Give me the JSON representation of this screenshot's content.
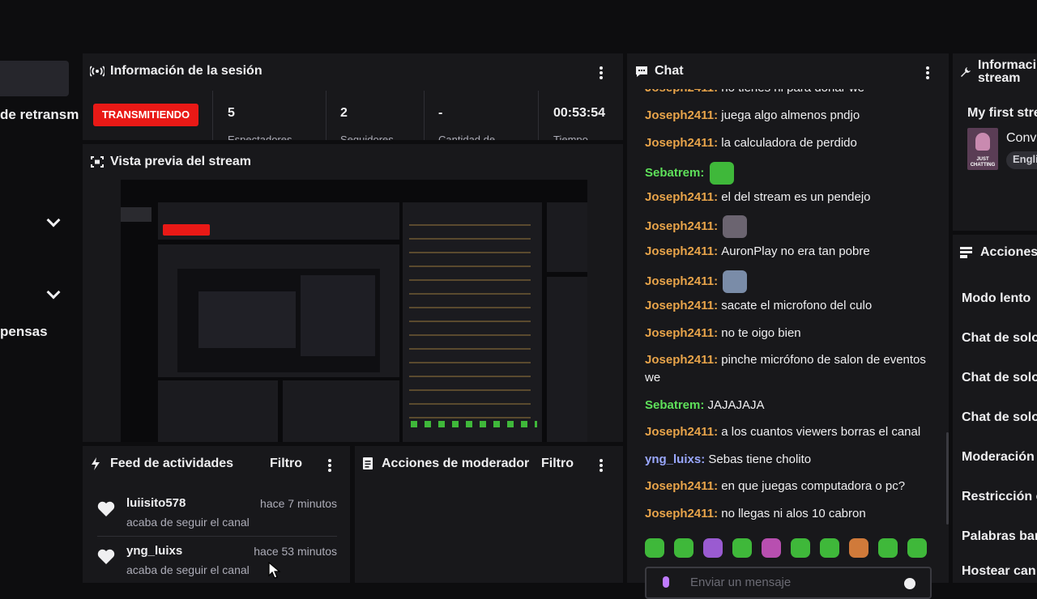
{
  "nav": {
    "item_retransmit": "de retransm",
    "item_recompensas": "pensas"
  },
  "session": {
    "title": "Información de la sesión",
    "live_badge": "TRANSMITIENDO",
    "stats": [
      {
        "value": "5",
        "label": "Espectadores"
      },
      {
        "value": "2",
        "label": "Seguidores"
      },
      {
        "value": "-",
        "label": "Cantidad de"
      },
      {
        "value": "00:53:54",
        "label": "Tiempo"
      }
    ]
  },
  "preview": {
    "title": "Vista previa del stream"
  },
  "feed": {
    "title": "Feed de actividades",
    "filter_label": "Filtro",
    "items": [
      {
        "name": "luiisito578",
        "time": "hace 7 minutos",
        "action": "acaba de seguir el canal"
      },
      {
        "name": "yng_luixs",
        "time": "hace 53 minutos",
        "action": "acaba de seguir el canal"
      }
    ]
  },
  "modactions": {
    "title": "Acciones de moderador",
    "filter_label": "Filtro"
  },
  "chat": {
    "title": "Chat",
    "input_placeholder": "Enviar un mensaje",
    "messages": [
      {
        "user": "Joseph2411",
        "text": "no tienes ni para donar we",
        "color": "#e8a44a"
      },
      {
        "user": "Joseph2411",
        "text": "juega algo almenos pndjo",
        "color": "#e8a44a"
      },
      {
        "user": "Joseph2411",
        "text": "la calculadora de perdido",
        "color": "#e8a44a"
      },
      {
        "user": "Sebatrem",
        "text": "",
        "color": "#5ee05a"
      },
      {
        "user": "Joseph2411",
        "text": "el del stream es un pendejo",
        "color": "#e8a44a"
      },
      {
        "user": "Joseph2411",
        "text": "",
        "color": "#e8a44a"
      },
      {
        "user": "Joseph2411",
        "text": "AuronPlay no era tan pobre",
        "color": "#e8a44a"
      },
      {
        "user": "Joseph2411",
        "text": "",
        "color": "#e8a44a"
      },
      {
        "user": "Joseph2411",
        "text": "sacate el microfono del culo",
        "color": "#e8a44a"
      },
      {
        "user": "Joseph2411",
        "text": "no te oigo bien",
        "color": "#e8a44a"
      },
      {
        "user": "Joseph2411",
        "text": "pinche micrófono de salon de eventos we",
        "color": "#e8a44a"
      },
      {
        "user": "Sebatrem",
        "text": "JAJAJAJA",
        "color": "#5ee05a"
      },
      {
        "user": "Joseph2411",
        "text": "a los cuantos viewers borras el canal",
        "color": "#e8a44a"
      },
      {
        "user": "yng_luixs",
        "text": "Sebas tiene cholito",
        "color": "#9aa8ff"
      },
      {
        "user": "Joseph2411",
        "text": "en que juegas computadora o pc?",
        "color": "#e8a44a"
      },
      {
        "user": "Joseph2411",
        "text": "no llegas ni alos 10 cabron",
        "color": "#e8a44a"
      }
    ]
  },
  "streaminfo": {
    "title_line1": "Informaci",
    "title_line2": "stream",
    "stream_title": "My first stre",
    "category": "Conv",
    "language_tag": "Engli",
    "thumb_text": "JUST CHATTING"
  },
  "quickactions": {
    "title": "Acciones",
    "items": [
      "Modo lento",
      "Chat de solo",
      "Chat de solo",
      "Chat de solo",
      "Moderación",
      "Restricción c",
      "Palabras bar",
      "Hostear can"
    ]
  },
  "colors": {
    "live_red": "#e91916",
    "panel_bg": "#18181b",
    "page_bg": "#0d0d0f",
    "user_orange": "#e8a44a",
    "user_green": "#5ee05a",
    "user_blue": "#9aa8ff"
  }
}
